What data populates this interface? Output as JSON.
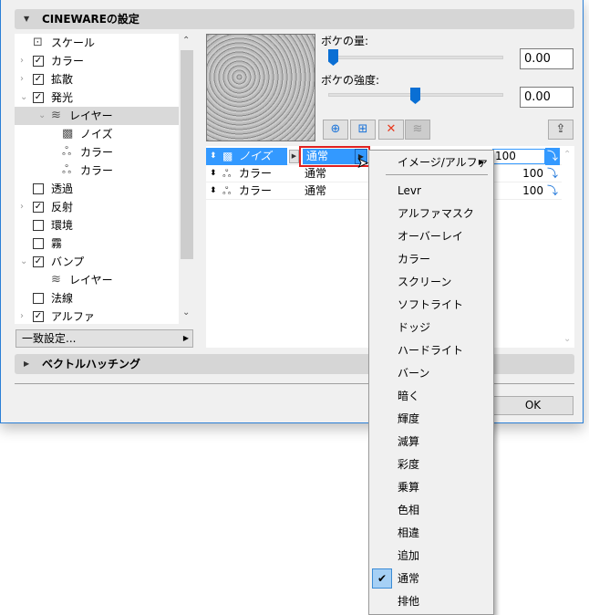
{
  "sections": {
    "cineware": "CINEWAREの設定",
    "hatching": "ベクトルハッチング"
  },
  "tree": [
    {
      "label": "スケール",
      "indent": 0,
      "chev": "",
      "check": null,
      "icon": "scale"
    },
    {
      "label": "カラー",
      "indent": 0,
      "chev": "›",
      "check": true
    },
    {
      "label": "拡散",
      "indent": 0,
      "chev": "›",
      "check": true
    },
    {
      "label": "発光",
      "indent": 0,
      "chev": "⌄",
      "check": true
    },
    {
      "label": "レイヤー",
      "indent": 1,
      "chev": "⌄",
      "check": null,
      "icon": "layers",
      "selected": true
    },
    {
      "label": "ノイズ",
      "indent": 2,
      "chev": "",
      "check": null,
      "icon": "noise"
    },
    {
      "label": "カラー",
      "indent": 2,
      "chev": "",
      "check": null,
      "icon": "color"
    },
    {
      "label": "カラー",
      "indent": 2,
      "chev": "",
      "check": null,
      "icon": "color"
    },
    {
      "label": "透過",
      "indent": 0,
      "chev": "",
      "check": false
    },
    {
      "label": "反射",
      "indent": 0,
      "chev": "›",
      "check": true
    },
    {
      "label": "環境",
      "indent": 0,
      "chev": "",
      "check": false
    },
    {
      "label": "霧",
      "indent": 0,
      "chev": "",
      "check": false
    },
    {
      "label": "バンプ",
      "indent": 0,
      "chev": "⌄",
      "check": true
    },
    {
      "label": "レイヤー",
      "indent": 1,
      "chev": "",
      "check": null,
      "icon": "layers"
    },
    {
      "label": "法線",
      "indent": 0,
      "chev": "",
      "check": false
    },
    {
      "label": "アルファ",
      "indent": 0,
      "chev": "›",
      "check": true
    }
  ],
  "match_button": "一致設定...",
  "bokeh_amount": {
    "label": "ボケの量:",
    "value": "0.00",
    "slider": 0.0
  },
  "bokeh_strength": {
    "label": "ボケの強度:",
    "value": "0.00",
    "slider": 0.5
  },
  "layers": [
    {
      "name": "ノイズ",
      "icon": "noise",
      "mode": "通常",
      "opacity": "100",
      "selected": true
    },
    {
      "name": "カラー",
      "icon": "color",
      "mode": "通常",
      "opacity": "100"
    },
    {
      "name": "カラー",
      "icon": "color",
      "mode": "通常",
      "opacity": "100"
    }
  ],
  "menu": {
    "submenu": "イメージ/アルファ",
    "items": [
      "Levr",
      "アルファマスク",
      "オーバーレイ",
      "カラー",
      "スクリーン",
      "ソフトライト",
      "ドッジ",
      "ハードライト",
      "バーン",
      "暗く",
      "輝度",
      "減算",
      "彩度",
      "乗算",
      "色相",
      "相違",
      "追加",
      "通常",
      "排他"
    ],
    "checked": "通常"
  },
  "ok": "OK",
  "colors": {
    "accent": "#3399ff",
    "highlight_border": "#e02020"
  }
}
